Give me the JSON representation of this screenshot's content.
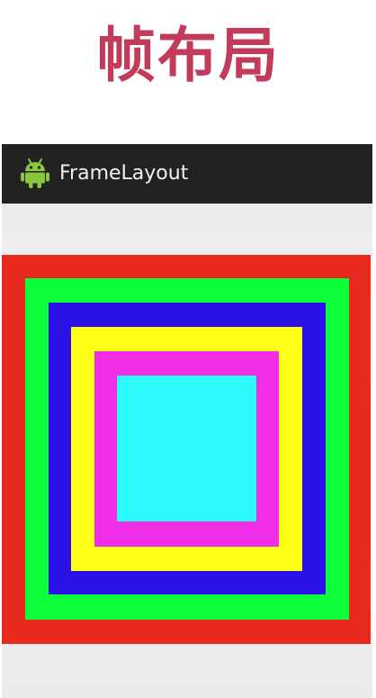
{
  "heading": {
    "text": "帧布局",
    "color": "#c23b5a"
  },
  "app": {
    "title": "FrameLayout",
    "icon": "android-robot-icon",
    "icon_color": "#8cc63e"
  },
  "frames": [
    {
      "color": "#e8291d"
    },
    {
      "color": "#0dff3a"
    },
    {
      "color": "#2a12e6"
    },
    {
      "color": "#ffff17"
    },
    {
      "color": "#f02ee8"
    },
    {
      "color": "#2dfbfb"
    }
  ]
}
